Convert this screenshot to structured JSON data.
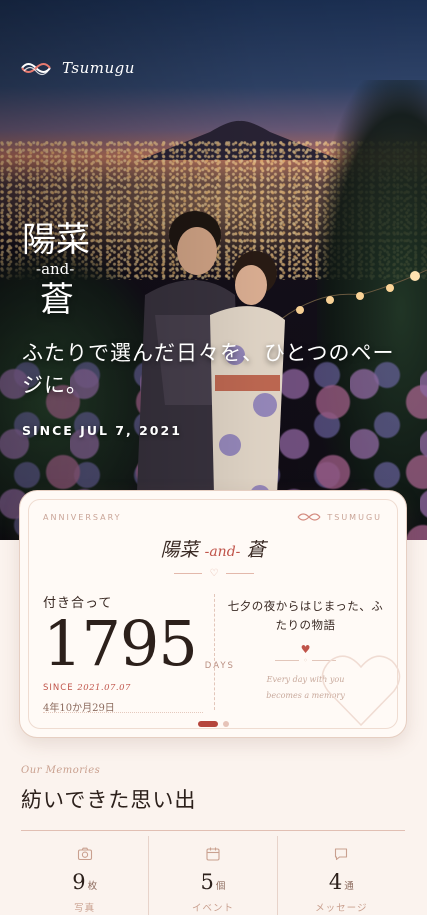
{
  "brand": {
    "name": "Tsumugu"
  },
  "hero": {
    "name_1": "陽菜",
    "name_and": "-and-",
    "name_2": "蒼",
    "tagline": "ふたりで選んだ日々を、ひとつのページに。",
    "since": "SINCE JUL 7, 2021"
  },
  "card": {
    "label_left": "ANNIVERSARY",
    "label_right": "TSUMUGU",
    "title_name_1": "陽菜",
    "title_and": "-and-",
    "title_name_2": "蒼",
    "together_label": "付き合って",
    "days": "1795",
    "days_unit": "DAYS",
    "since_label": "SINCE",
    "since_date": "2021.07.07",
    "duration": "4年10か月29日",
    "story": "七夕の夜からはじまった、ふたりの物語",
    "subtext_1": "Every day with you",
    "subtext_2": "becomes a memory",
    "pager": {
      "count": 2,
      "active": 0
    }
  },
  "memories": {
    "eyebrow": "Our Memories",
    "title": "紡いできた思い出",
    "stats": [
      {
        "icon": "camera-icon",
        "value": "9",
        "unit": "枚",
        "label": "写真"
      },
      {
        "icon": "calendar-icon",
        "value": "5",
        "unit": "個",
        "label": "イベント"
      },
      {
        "icon": "chat-bubble-icon",
        "value": "4",
        "unit": "通",
        "label": "メッセージ"
      }
    ]
  },
  "colors": {
    "accent": "#c0544a",
    "background": "#fbf3ee",
    "muted": "#c9a08f"
  }
}
